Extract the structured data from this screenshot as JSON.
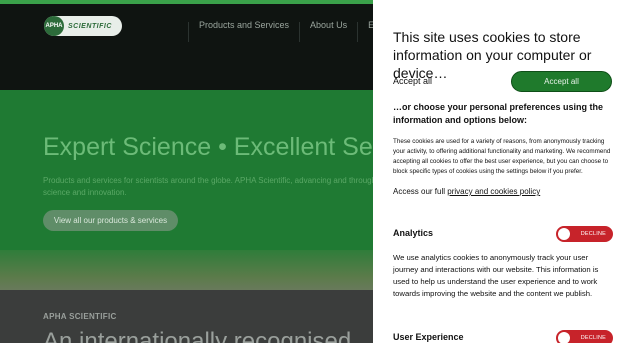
{
  "site": {
    "logo_badge": "APHA",
    "logo_text": "SCIENTIFIC",
    "nav": [
      "Products and Services",
      "About Us",
      "Events"
    ],
    "hero_title": "Expert Science • Excellent Servi",
    "hero_sub": "Products and services for scientists around the globe. APHA Scientific, advancing and through science and innovation.",
    "hero_button": "View all our products & services",
    "kicker": "APHA SCIENTIFIC",
    "lower_title": "An internationally recognised"
  },
  "cookies": {
    "title": "This site uses cookies to store information on your computer or device…",
    "accept_label": "Accept all",
    "accept_button": "Accept all",
    "or_title": "…or choose your personal preferences using the information and options below:",
    "description": "These cookies are used for a variety of reasons, from anonymously tracking your activity, to offering additional functionality and marketing. We recommend accepting all cookies to offer the best user experience, but you can choose to block specific types of cookies using the settings below if you prefer.",
    "access_prefix": "Access our full",
    "access_link": "privacy and cookies policy",
    "sections": [
      {
        "label": "Analytics",
        "toggle": "DECLINE",
        "text": "We use analytics cookies to anonymously track your user journey and interactions with our website. This information is used to help us understand the user experience and to work towards improving the website and the content we publish."
      },
      {
        "label": "User Experience",
        "toggle": "DECLINE"
      }
    ]
  },
  "colors": {
    "accent_green": "#1f7a2c",
    "decline_red": "#c7232a"
  }
}
